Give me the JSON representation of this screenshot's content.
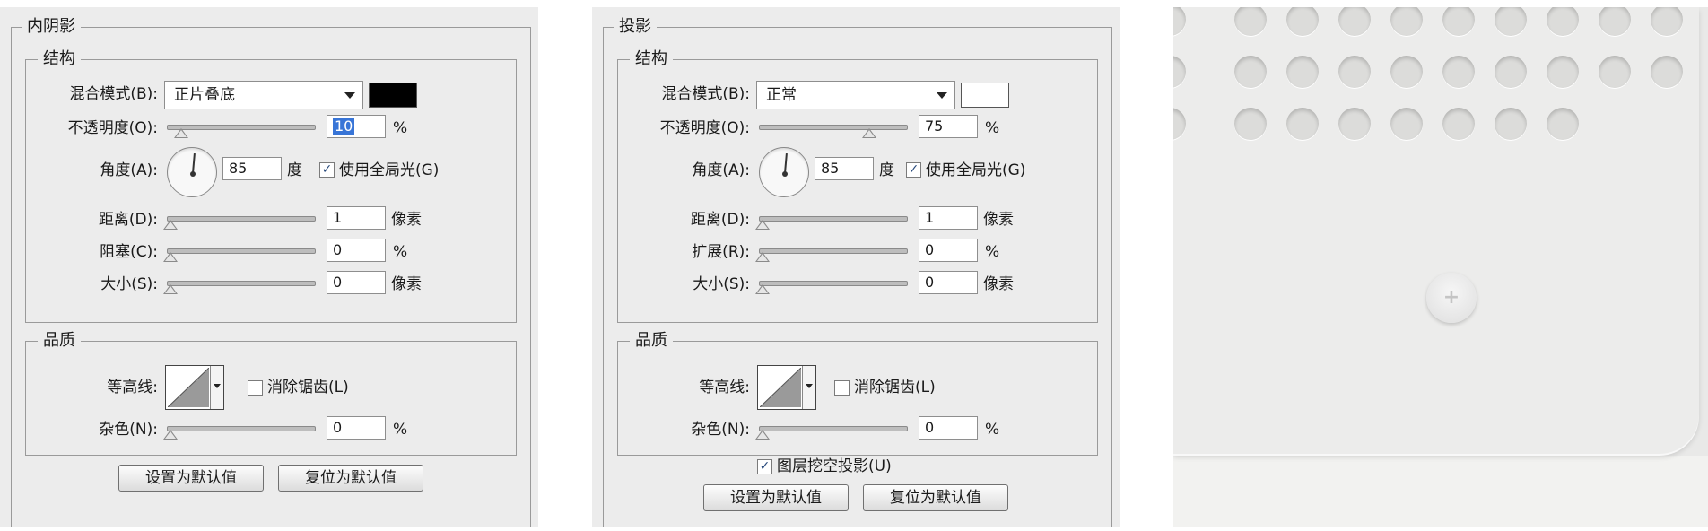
{
  "inner_shadow": {
    "title": "内阴影",
    "structure": {
      "title": "结构",
      "blend_label": "混合模式(B):",
      "blend_value": "正片叠底",
      "blend_color": "#000000",
      "opacity_label": "不透明度(O):",
      "opacity_value": "10",
      "opacity_unit": "%",
      "opacity_level": 0.1,
      "angle_label": "角度(A):",
      "angle_value": "85",
      "angle_unit": "度",
      "global_light_checked": "✓",
      "global_light_label": "使用全局光(G)",
      "distance_label": "距离(D):",
      "distance_value": "1",
      "distance_unit": "像素",
      "choke_label": "阻塞(C):",
      "choke_value": "0",
      "choke_unit": "%",
      "size_label": "大小(S):",
      "size_value": "0",
      "size_unit": "像素"
    },
    "quality": {
      "title": "品质",
      "contour_label": "等高线:",
      "antialias_label": "消除锯齿(L)",
      "noise_label": "杂色(N):",
      "noise_value": "0",
      "noise_unit": "%"
    },
    "buttons": {
      "set_default": "设置为默认值",
      "reset_default": "复位为默认值"
    }
  },
  "drop_shadow": {
    "title": "投影",
    "structure": {
      "title": "结构",
      "blend_label": "混合模式(B):",
      "blend_value": "正常",
      "blend_color": "#ffffff",
      "opacity_label": "不透明度(O):",
      "opacity_value": "75",
      "opacity_unit": "%",
      "opacity_level": 0.75,
      "angle_label": "角度(A):",
      "angle_value": "85",
      "angle_unit": "度",
      "global_light_checked": "✓",
      "global_light_label": "使用全局光(G)",
      "distance_label": "距离(D):",
      "distance_value": "1",
      "distance_unit": "像素",
      "spread_label": "扩展(R):",
      "spread_value": "0",
      "spread_unit": "%",
      "size_label": "大小(S):",
      "size_value": "0",
      "size_unit": "像素"
    },
    "quality": {
      "title": "品质",
      "contour_label": "等高线:",
      "antialias_label": "消除锯齿(L)",
      "noise_label": "杂色(N):",
      "noise_value": "0",
      "noise_unit": "%"
    },
    "knockout_checked": "✓",
    "knockout_label": "图层挖空投影(U)",
    "buttons": {
      "set_default": "设置为默认值",
      "reset_default": "复位为默认值"
    }
  },
  "preview": {
    "screw_symbol": "+"
  }
}
